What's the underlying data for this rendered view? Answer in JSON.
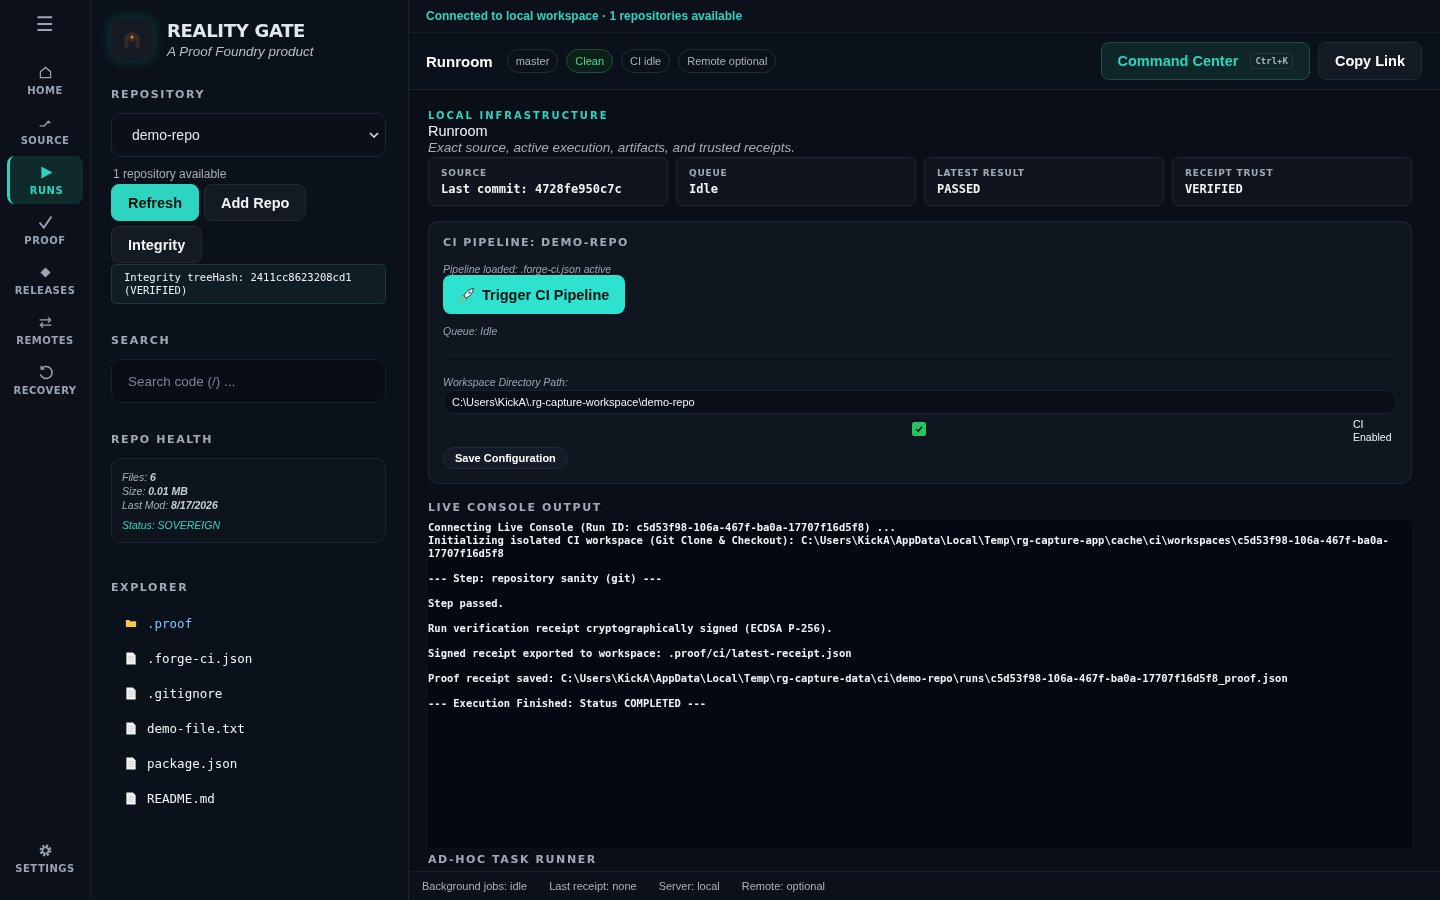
{
  "nav": {
    "menu_glyph": "☰",
    "items": [
      {
        "label": "HOME",
        "selected": false
      },
      {
        "label": "SOURCE",
        "selected": false
      },
      {
        "label": "RUNS",
        "selected": true
      },
      {
        "label": "PROOF",
        "selected": false
      },
      {
        "label": "RELEASES",
        "selected": false
      },
      {
        "label": "REMOTES",
        "selected": false
      },
      {
        "label": "RECOVERY",
        "selected": false
      }
    ],
    "settings": {
      "label": "SETTINGS"
    }
  },
  "brand": {
    "title": "REALITY GATE",
    "subtitle": "A Proof Foundry product"
  },
  "repository": {
    "heading": "REPOSITORY",
    "value": "demo-repo",
    "count": "1 repository available",
    "buttons": [
      {
        "label": "Refresh",
        "kind": "primary"
      },
      {
        "label": "Add Repo",
        "kind": "secondary"
      },
      {
        "label": "Integrity",
        "kind": "secondary"
      }
    ],
    "integrity": "Integrity treeHash: 2411cc8623208cd1 (VERIFIED)"
  },
  "search": {
    "heading": "SEARCH",
    "placeholder": "Search code (/) ..."
  },
  "repo_health": {
    "heading": "REPO HEALTH",
    "stats": [
      {
        "label": "Files:",
        "value": "6"
      },
      {
        "label": "Size:",
        "value": "0.01 MB"
      },
      {
        "label": "Last Mod:",
        "value": "8/17/2026"
      }
    ],
    "status": "Status: SOVEREIGN"
  },
  "explorer": {
    "heading": "EXPLORER",
    "items": [
      {
        "name": ".proof",
        "kind": "folder"
      },
      {
        "name": ".forge-ci.json",
        "kind": "file"
      },
      {
        "name": ".gitignore",
        "kind": "file"
      },
      {
        "name": "demo-file.txt",
        "kind": "file"
      },
      {
        "name": "package.json",
        "kind": "file"
      },
      {
        "name": "README.md",
        "kind": "file"
      }
    ]
  },
  "banner": "Connected to local workspace · 1 repositories available",
  "header": {
    "title": "Runroom",
    "chips": [
      {
        "label": "master",
        "kind": "plain"
      },
      {
        "label": "Clean",
        "kind": "good"
      },
      {
        "label": "CI idle",
        "kind": "plain"
      },
      {
        "label": "Remote optional",
        "kind": "plain"
      }
    ],
    "command_center": {
      "label": "Command Center",
      "shortcut": "Ctrl+K"
    },
    "copy_link": "Copy Link"
  },
  "intro": {
    "eyebrow": "LOCAL INFRASTRUCTURE",
    "title": "Runroom",
    "subtitle": "Exact source, active execution, artifacts, and trusted receipts."
  },
  "stats": [
    {
      "label": "SOURCE",
      "value": "Last commit: 4728fe950c7c"
    },
    {
      "label": "QUEUE",
      "value": "Idle"
    },
    {
      "label": "LATEST RESULT",
      "value": "PASSED"
    },
    {
      "label": "RECEIPT TRUST",
      "value": "VERIFIED"
    }
  ],
  "pipeline": {
    "heading": "CI PIPELINE: DEMO-REPO",
    "loaded": "Pipeline loaded: .forge-ci.json active",
    "trigger": "Trigger CI Pipeline",
    "queue": "Queue: Idle",
    "path_label": "Workspace Directory Path:",
    "path_value": "C:\\Users\\KickA\\.rg-capture-workspace\\demo-repo",
    "ci_enabled": {
      "checked": true,
      "label": "CI Enabled"
    },
    "save": "Save Configuration"
  },
  "console": {
    "heading": "LIVE CONSOLE OUTPUT",
    "blocks": [
      {
        "lines": [
          "Connecting Live Console (Run ID: c5d53f98-106a-467f-ba0a-17707f16d5f8) ...",
          "Initializing isolated CI workspace (Git Clone & Checkout): C:\\Users\\KickA\\AppData\\Local\\Temp\\rg-capture-app\\cache\\ci\\workspaces\\c5d53f98-106a-467f-ba0a-17707f16d5f8"
        ]
      },
      {
        "lines": [
          "--- Step: repository sanity (git) ---"
        ]
      },
      {
        "lines": [
          "Step passed."
        ]
      },
      {
        "lines": [
          "Run verification receipt cryptographically signed (ECDSA P-256)."
        ]
      },
      {
        "lines": [
          "Signed receipt exported to workspace: .proof/ci/latest-receipt.json"
        ]
      },
      {
        "lines": [
          "Proof receipt saved: C:\\Users\\KickA\\AppData\\Local\\Temp\\rg-capture-data\\ci\\demo-repo\\runs\\c5d53f98-106a-467f-ba0a-17707f16d5f8_proof.json"
        ]
      },
      {
        "lines": [
          "--- Execution Finished: Status COMPLETED ---"
        ]
      }
    ]
  },
  "next_section": "AD-HOC TASK RUNNER",
  "status_bar": [
    "Background jobs: idle",
    "Last receipt: none",
    "Server: local",
    "Remote: optional"
  ]
}
